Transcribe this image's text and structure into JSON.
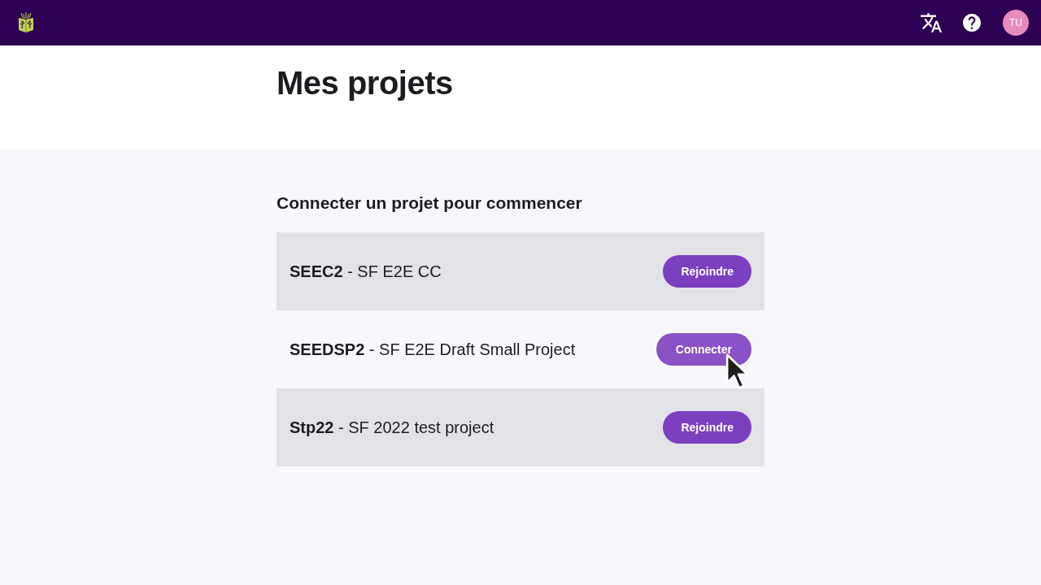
{
  "app_bar": {
    "avatar_initials": "TU"
  },
  "page": {
    "title": "Mes projets"
  },
  "projects": {
    "heading": "Connecter un projet pour commencer",
    "items": [
      {
        "label": "**SEEC2** - SF E2E CC",
        "action": "Rejoindre",
        "hovered": false
      },
      {
        "label": "**SEEDSP2** - SF E2E Draft Small Project",
        "action": "Connecter",
        "hovered": true
      },
      {
        "label": "**Stp22** - SF 2022 test project",
        "action": "Rejoindre",
        "hovered": false
      }
    ]
  }
}
